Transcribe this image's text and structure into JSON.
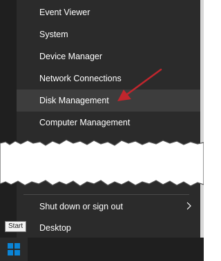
{
  "menu": {
    "items_top": [
      {
        "label": "Event Viewer"
      },
      {
        "label": "System"
      },
      {
        "label": "Device Manager"
      },
      {
        "label": "Network Connections"
      },
      {
        "label": "Disk Management"
      },
      {
        "label": "Computer Management"
      }
    ],
    "items_bottom": [
      {
        "label": "Shut down or sign out",
        "has_submenu": true
      },
      {
        "label": "Desktop"
      }
    ],
    "highlighted_item": "Disk Management"
  },
  "tooltip": {
    "text": "Start"
  },
  "colors": {
    "menu_bg": "#2b2b2b",
    "highlight_bg": "#3d3d3d",
    "text": "#ffffff",
    "arrow": "#c0262d",
    "start_blue": "#0a84d6"
  },
  "icons": {
    "start": "windows-logo-icon",
    "submenu": "chevron-right-icon",
    "annotation": "red-arrow-icon"
  }
}
